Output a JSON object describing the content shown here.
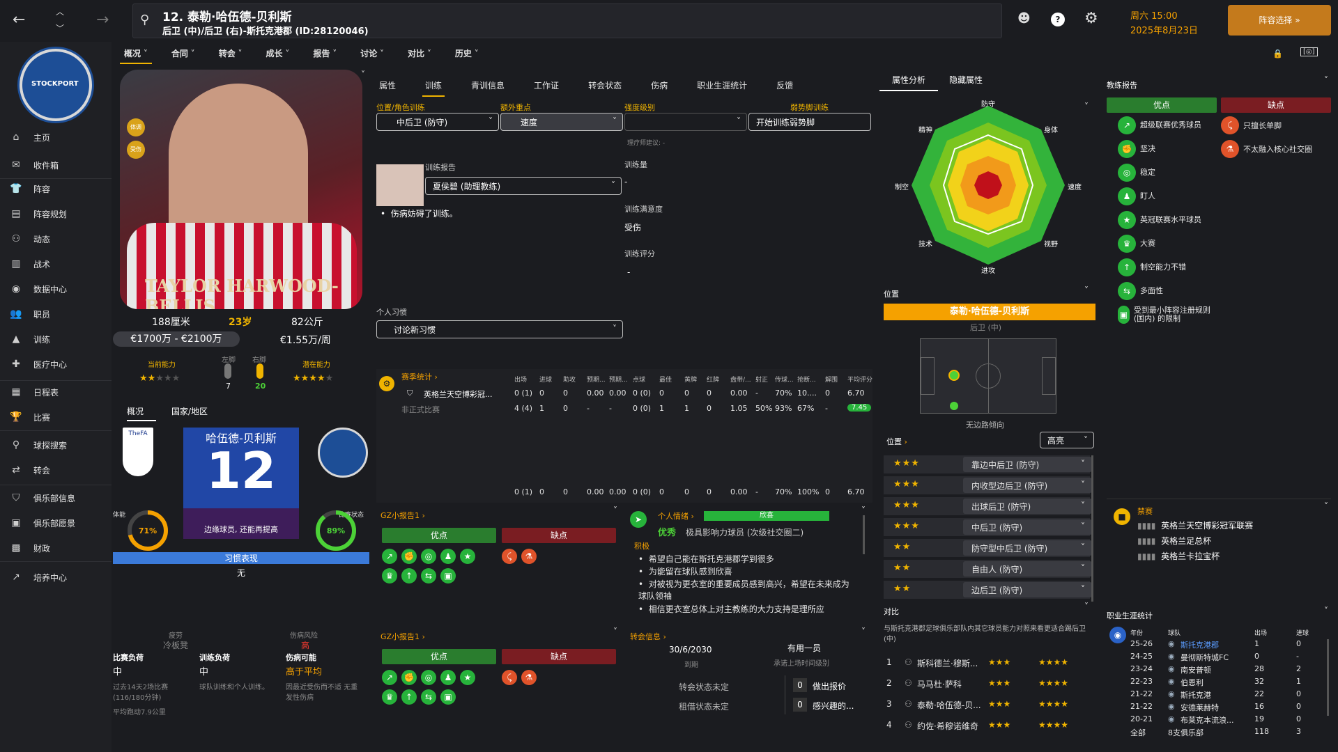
{
  "header": {
    "player_line": "12. 泰勒·哈伍德-贝利斯",
    "player_sub": "后卫 (中)/后卫 (右)-斯托克港郡 (ID:28120046)",
    "date_line1": "周六 15:00",
    "date_line2": "2025年8月23日",
    "lineup_btn": "阵容选择"
  },
  "sidebar": {
    "items": [
      "主页",
      "收件箱",
      "阵容",
      "阵容规划",
      "动态",
      "战术",
      "数据中心",
      "职员",
      "训练",
      "医疗中心",
      "日程表",
      "比赛",
      "球探搜索",
      "转会",
      "俱乐部信息",
      "俱乐部愿景",
      "财政",
      "培养中心"
    ]
  },
  "nav1": [
    "概况",
    "合同",
    "转会",
    "成长",
    "报告",
    "讨论",
    "对比",
    "历史"
  ],
  "tabs2": [
    "属性",
    "训练",
    "青训信息",
    "工作证",
    "转会状态",
    "伤病",
    "职业生涯统计",
    "反馈"
  ],
  "player": {
    "name_on_card": "TAYLOR HARWOOD-BELLIS",
    "height": "188厘米",
    "age": "23岁",
    "weight": "82公斤",
    "value": "€1700万 - €2100万",
    "wage": "€1.55万/周",
    "current_ability": "当前能力",
    "potential_ability": "潜在能力",
    "left_foot": "左脚",
    "right_foot": "右脚",
    "left_val": "7",
    "right_val": "20",
    "badge1": "体调",
    "badge2": "受伤"
  },
  "overview": {
    "tab1": "概况",
    "tab2": "国家/地区",
    "shirt_name": "哈伍德-贝利斯",
    "shirt_number": "12",
    "fitness_label": "体能",
    "fitness_val": "71%",
    "condition_label": "比赛状态",
    "condition_val": "89%",
    "role_desc": "边缘球员, 还能再提高",
    "form_label": "习惯表现",
    "form_val": "无"
  },
  "load": {
    "fatigue_label": "疲劳",
    "fatigue_val": "冷板凳",
    "injury_risk_label": "伤病风险",
    "injury_risk_val": "高",
    "match_load_label": "比赛负荷",
    "match_load_val": "中",
    "train_load_label": "训练负荷",
    "train_load_val": "中",
    "injury_chance_label": "伤病可能",
    "injury_chance_val": "高于平均",
    "match_desc": "过去14天2场比赛 (116/180分钟)",
    "train_desc": "球队训练和个人训练。",
    "injury_desc": "因最近受伤而不适 无重发性伤病",
    "distance": "平均跑动7.9公里"
  },
  "training": {
    "pos_label": "位置/角色训练",
    "pos_val": "中后卫 (防守)",
    "extra_label": "额外重点",
    "extra_val": "速度",
    "intensity_label": "强度级别",
    "weak_label": "弱势脚训练",
    "weak_btn": "开始训练弱势脚",
    "physio": "理疗师建议: -",
    "report_label": "训练报告",
    "coach": "夏侯碧 (助理教练)",
    "injury_note": "伤病妨碍了训练。",
    "vol_label": "训练量",
    "vol_val": "-",
    "sat_label": "训练满意度",
    "sat_val": "受伤",
    "rating_label": "训练评分",
    "rating_val": "-",
    "habit_label": "个人习惯",
    "habit_val": "讨论新习惯"
  },
  "stats": {
    "title": "赛季统计",
    "headers": [
      "出场",
      "进球",
      "助攻",
      "预期...",
      "预期...",
      "点球",
      "最佳",
      "黄牌",
      "红牌",
      "盘带/...",
      "射正",
      "传球...",
      "抢断...",
      "解围",
      "平均评分"
    ],
    "row1_name": "英格兰天空博彩冠...",
    "row1": [
      "0 (1)",
      "0",
      "0",
      "0.00",
      "0.00",
      "0 (0)",
      "0",
      "0",
      "0",
      "0.00",
      "-",
      "70%",
      "10....",
      "0",
      "6.70"
    ],
    "row2_name": "非正式比赛",
    "row2": [
      "4 (4)",
      "1",
      "0",
      "-",
      "-",
      "0 (0)",
      "1",
      "1",
      "0",
      "1.05",
      "50%",
      "93%",
      "67%",
      "-",
      "7.45"
    ],
    "total": [
      "0 (1)",
      "0",
      "0",
      "0.00",
      "0.00",
      "0 (0)",
      "0",
      "0",
      "0",
      "0.00",
      "-",
      "70%",
      "100%",
      "0",
      "6.70"
    ]
  },
  "gz": {
    "title1": "GZ小报告1",
    "title2": "GZ小报告1",
    "pro": "优点",
    "con": "缺点"
  },
  "personal": {
    "title": "个人情绪",
    "bar": "欣喜",
    "level": "优秀",
    "type": "极具影响力球员 (次级社交圈二)",
    "pos_head": "积极",
    "bullets": [
      "希望自己能在斯托克港郡学到很多",
      "为能留在球队感到欣喜",
      "对被视为更衣室的重要成员感到高兴，希望在未来成为球队领袖",
      "相信更衣室总体上对主教练的大力支持是理所应"
    ]
  },
  "transfer": {
    "title": "转会信息",
    "date": "30/6/2030",
    "expiry": "到期",
    "useful": "有用一员",
    "useful_sub": "承诺上场时间级别",
    "status1": "转会状态未定",
    "status2": "租借状态未定",
    "offer_n": "0",
    "offer": "做出报价",
    "interest_n": "0",
    "interest": "感兴趣的..."
  },
  "attr": {
    "tab1": "属性分析",
    "tab2": "隐藏属性",
    "labels": [
      "防守",
      "身体",
      "速度",
      "视野",
      "进攻",
      "技术",
      "制空",
      "精神"
    ]
  },
  "position": {
    "title": "位置",
    "name": "泰勒·哈伍德-贝利斯",
    "role": "后卫 (中)",
    "side_note": "无边路倾向",
    "list_title": "位置",
    "highlight": "高亮",
    "roles": [
      "靠边中后卫 (防守)",
      "内收型边后卫 (防守)",
      "出球后卫 (防守)",
      "中后卫 (防守)",
      "防守型中后卫 (防守)",
      "自由人 (防守)",
      "边后卫 (防守)"
    ],
    "stars": [
      "★★★",
      "★★★",
      "★★★",
      "★★★",
      "★★",
      "★★",
      "★★"
    ]
  },
  "compare": {
    "title": "对比",
    "desc": "与斯托克港郡足球俱乐部队内其它球员能力对照来看更适合踢后卫 (中)",
    "rows": [
      {
        "n": "1",
        "name": "斯科德兰·穆斯...",
        "a": "★★★",
        "p": "★★★★"
      },
      {
        "n": "2",
        "name": "马马杜·萨科",
        "a": "★★★",
        "p": "★★★★"
      },
      {
        "n": "3",
        "name": "泰勒·哈伍德-贝...",
        "a": "★★★",
        "p": "★★★★"
      },
      {
        "n": "4",
        "name": "约佐·希穆诺维奇",
        "a": "★★★",
        "p": "★★★★"
      }
    ]
  },
  "coach_report": {
    "title": "教练报告",
    "pro": "优点",
    "con": "缺点",
    "pros": [
      "超级联赛优秀球员",
      "坚决",
      "稳定",
      "盯人",
      "英冠联赛水平球员",
      "大赛",
      "制空能力不错",
      "多面性",
      "受到最小阵容注册规则 (国内) 的限制"
    ],
    "cons": [
      "只擅长单脚",
      "不太融入核心社交圈"
    ]
  },
  "ban": {
    "title": "禁赛",
    "items": [
      "英格兰天空博彩冠军联赛",
      "英格兰足总杯",
      "英格兰卡拉宝杯"
    ]
  },
  "career": {
    "title": "职业生涯统计",
    "h_year": "年份",
    "h_club": "球队",
    "h_apps": "出场",
    "h_goals": "进球",
    "rows": [
      [
        "25-26",
        "斯托克港郡",
        "1",
        "0"
      ],
      [
        "24-25",
        "曼彻斯特城FC",
        "0",
        "-"
      ],
      [
        "23-24",
        "南安普顿",
        "28",
        "2"
      ],
      [
        "22-23",
        "伯恩利",
        "32",
        "1"
      ],
      [
        "21-22",
        "斯托克港",
        "22",
        "0"
      ],
      [
        "21-22",
        "安德莱赫特",
        "16",
        "0"
      ],
      [
        "20-21",
        "布莱克本流浪...",
        "19",
        "0"
      ]
    ],
    "total": [
      "全部",
      "8支俱乐部",
      "118",
      "3"
    ]
  }
}
